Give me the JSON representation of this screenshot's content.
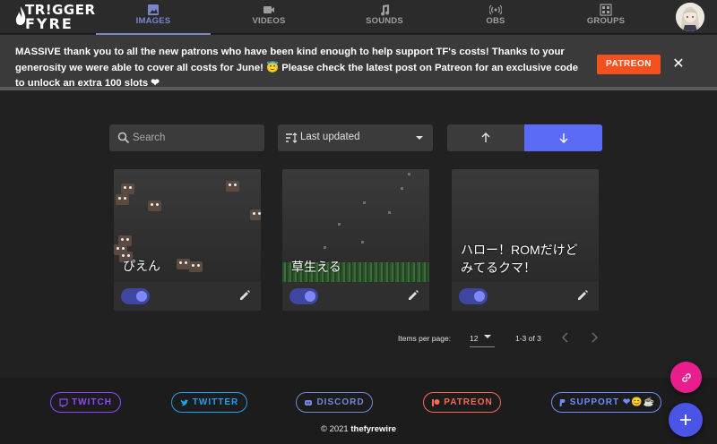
{
  "brand": {
    "line1": "TR!GGER",
    "line2": "FYRE"
  },
  "nav": {
    "tabs": [
      {
        "label": "IMAGES",
        "icon": "image-icon",
        "active": true
      },
      {
        "label": "VIDEOS",
        "icon": "video-icon",
        "active": false
      },
      {
        "label": "SOUNDS",
        "icon": "music-note-icon",
        "active": false
      },
      {
        "label": "OBS",
        "icon": "broadcast-icon",
        "active": false
      },
      {
        "label": "GROUPS",
        "icon": "grid-icon",
        "active": false
      }
    ],
    "avatar_icon": "user-avatar"
  },
  "banner": {
    "message": "MASSIVE thank you to all the new patrons who have been kind enough to help support TF's costs! Thanks to your generosity we were able to cover all costs for June! 😇 Please check the latest post on Patreon for an exclusive code to unlock an extra 100 slots ❤",
    "button_label": "PATREON",
    "close_label": "✕"
  },
  "controls": {
    "search_placeholder": "Search",
    "sort_value": "Last updated",
    "direction_up_icon": "arrow-up-icon",
    "direction_down_icon": "arrow-down-icon",
    "direction_selected": "down"
  },
  "cards": [
    {
      "title": "ぴえん",
      "enabled": true
    },
    {
      "title": "草生える",
      "enabled": true
    },
    {
      "title": "ハロー！ROMだけどみてるクマ！",
      "enabled": true
    }
  ],
  "pagination": {
    "items_per_page_label": "Items per page:",
    "items_per_page_value": "12",
    "range_label": "1-3 of 3",
    "prev_icon": "chevron-left-icon",
    "next_icon": "chevron-right-icon"
  },
  "footer": {
    "links": [
      {
        "label": "TWITCH",
        "color": "#9146ff",
        "icon": "twitch-icon"
      },
      {
        "label": "TWITTER",
        "color": "#1da1f2",
        "icon": "twitter-icon"
      },
      {
        "label": "DISCORD",
        "color": "#7289da",
        "icon": "discord-icon"
      },
      {
        "label": "PATREON",
        "color": "#f96854",
        "icon": "patreon-icon"
      },
      {
        "label": "SUPPORT ❤😊☕",
        "color": "#6c8cff",
        "icon": "paypal-icon"
      }
    ],
    "copyright": "© 2021",
    "owner": "thefyrewire"
  },
  "fabs": [
    {
      "icon": "link-icon",
      "color": "#e91e8c"
    },
    {
      "icon": "plus-icon",
      "color": "#4a55e8"
    }
  ],
  "colors": {
    "accent": "#7986cb",
    "primary": "#5c6bf5",
    "patreon": "#f4511e"
  }
}
